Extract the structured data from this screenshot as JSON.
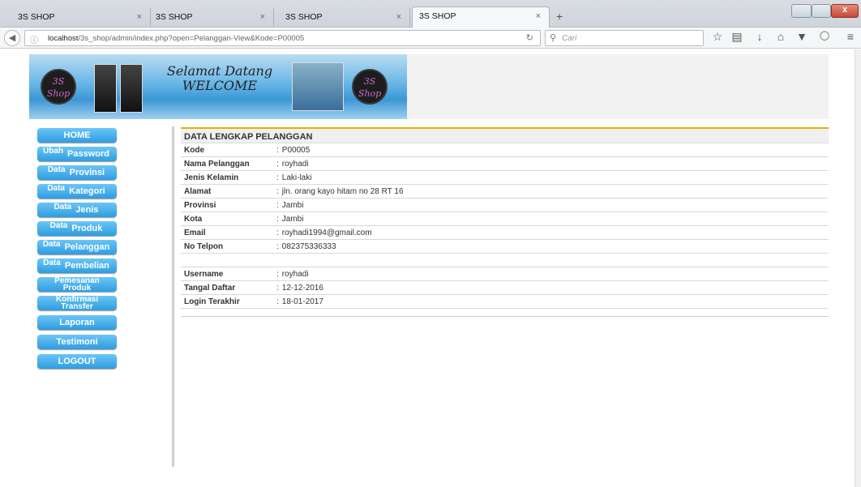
{
  "browser": {
    "tabs": [
      {
        "label": "3S SHOP"
      },
      {
        "label": "3S SHOP"
      },
      {
        "label": "3S SHOP"
      },
      {
        "label": "3S SHOP"
      }
    ],
    "new_tab_label": "+",
    "close_tab_symbol": "×",
    "url_host": "localhost",
    "url_path": "/3s_shop/admin/index.php?open=Pelanggan-View&Kode=P00005",
    "search_placeholder": "Cari",
    "toolbar_icons": [
      "star-icon",
      "reading-list-icon",
      "download-icon",
      "home-icon",
      "pocket-icon",
      "extension-icon",
      "menu-icon"
    ]
  },
  "banner": {
    "logo_text_top": "3S",
    "logo_text_bottom": "Shop",
    "welcome_line1": "Selamat Datang",
    "welcome_line2": "WELCOME"
  },
  "sidebar": {
    "items": [
      {
        "label": "HOME"
      },
      {
        "prefix": "Ubah",
        "label": "Password"
      },
      {
        "prefix": "Data",
        "label": "Provinsi"
      },
      {
        "prefix": "Data",
        "label": "Kategori"
      },
      {
        "prefix": "Data",
        "label": "Jenis"
      },
      {
        "prefix": "Data",
        "label": "Produk"
      },
      {
        "prefix": "Data",
        "label": "Pelanggan"
      },
      {
        "prefix": "Data",
        "label": "Pembelian"
      },
      {
        "line1": "Pemesanan",
        "line2": "Produk"
      },
      {
        "line1": "Konfirmasi",
        "line2": "Transfer"
      },
      {
        "label": "Laporan"
      },
      {
        "label": "Testimoni"
      },
      {
        "label": "LOGOUT"
      }
    ]
  },
  "detail": {
    "title": "DATA LENGKAP PELANGGAN",
    "sep": ":",
    "rows": [
      {
        "label": "Kode",
        "value": "P00005"
      },
      {
        "label": "Nama Pelanggan",
        "value": "royhadi"
      },
      {
        "label": "Jenis Kelamin",
        "value": "Laki-laki"
      },
      {
        "label": "Alamat",
        "value": "jln. orang kayo hitam no 28 RT 16"
      },
      {
        "label": "Provinsi",
        "value": "Jambi"
      },
      {
        "label": "Kota",
        "value": "Jambi"
      },
      {
        "label": "Email",
        "value": "royhadi1994@gmail.com"
      },
      {
        "label": "No Telpon",
        "value": "082375336333"
      }
    ],
    "account_rows": [
      {
        "label": "Username",
        "value": "royhadi"
      },
      {
        "label": "Tangal Daftar",
        "value": "12-12-2016"
      },
      {
        "label": "Login Terakhir",
        "value": "18-01-2017"
      }
    ]
  },
  "colors": {
    "menu": "#2e9de0",
    "accent_line": "#e6b000"
  }
}
